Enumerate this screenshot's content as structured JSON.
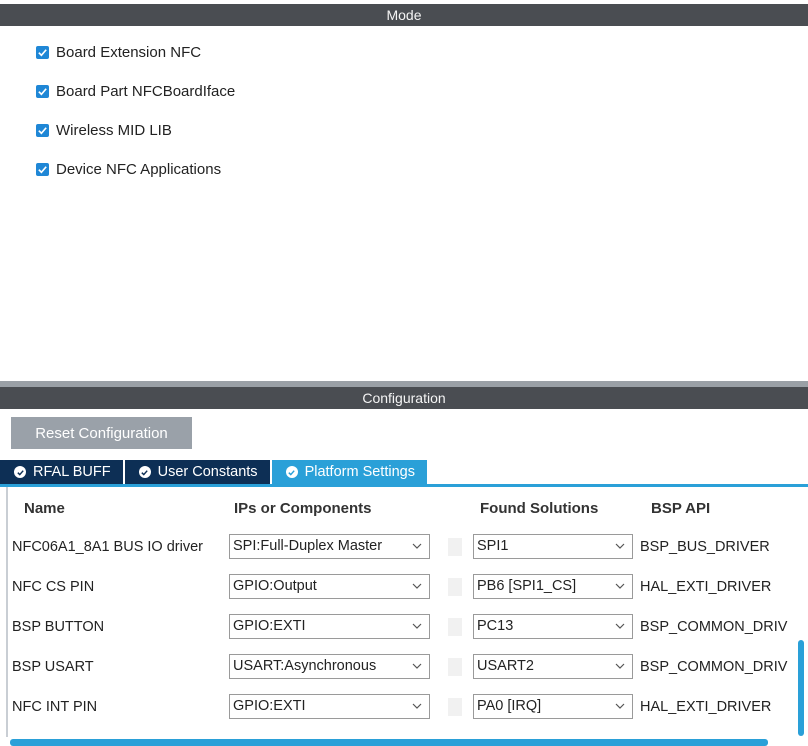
{
  "mode": {
    "header": "Mode",
    "checkboxes": [
      {
        "label": "Board Extension NFC",
        "checked": true
      },
      {
        "label": "Board Part NFCBoardIface",
        "checked": true
      },
      {
        "label": "Wireless MID LIB",
        "checked": true
      },
      {
        "label": "Device NFC Applications",
        "checked": true
      }
    ]
  },
  "configuration": {
    "header": "Configuration",
    "reset_label": "Reset Configuration",
    "tabs": [
      {
        "label": "RFAL BUFF",
        "active": false
      },
      {
        "label": "User Constants",
        "active": false
      },
      {
        "label": "Platform Settings",
        "active": true
      }
    ],
    "table": {
      "headers": [
        "Name",
        "IPs or Components",
        "Found Solutions",
        "BSP API"
      ],
      "rows": [
        {
          "name": "NFC06A1_8A1 BUS IO driver",
          "ip": "SPI:Full-Duplex Master",
          "solution": "SPI1",
          "api": "BSP_BUS_DRIVER"
        },
        {
          "name": "NFC CS PIN",
          "ip": "GPIO:Output",
          "solution": "PB6 [SPI1_CS]",
          "api": "HAL_EXTI_DRIVER"
        },
        {
          "name": "BSP BUTTON",
          "ip": "GPIO:EXTI",
          "solution": "PC13",
          "api": "BSP_COMMON_DRIV"
        },
        {
          "name": "BSP USART",
          "ip": "USART:Asynchronous",
          "solution": "USART2",
          "api": "BSP_COMMON_DRIV"
        },
        {
          "name": "NFC INT PIN",
          "ip": "GPIO:EXTI",
          "solution": "PA0 [IRQ]",
          "api": "HAL_EXTI_DRIVER"
        }
      ]
    }
  },
  "colors": {
    "header_bg": "#4a4d52",
    "accent": "#2aa0d8",
    "tab_inactive": "#0d2f55",
    "checkbox": "#1f87d6",
    "reset_button": "#9aa1a9"
  },
  "icons": {
    "checkbox": "checkmark-icon",
    "tab_status": "check-circle-icon",
    "dropdown": "chevron-down-icon"
  }
}
